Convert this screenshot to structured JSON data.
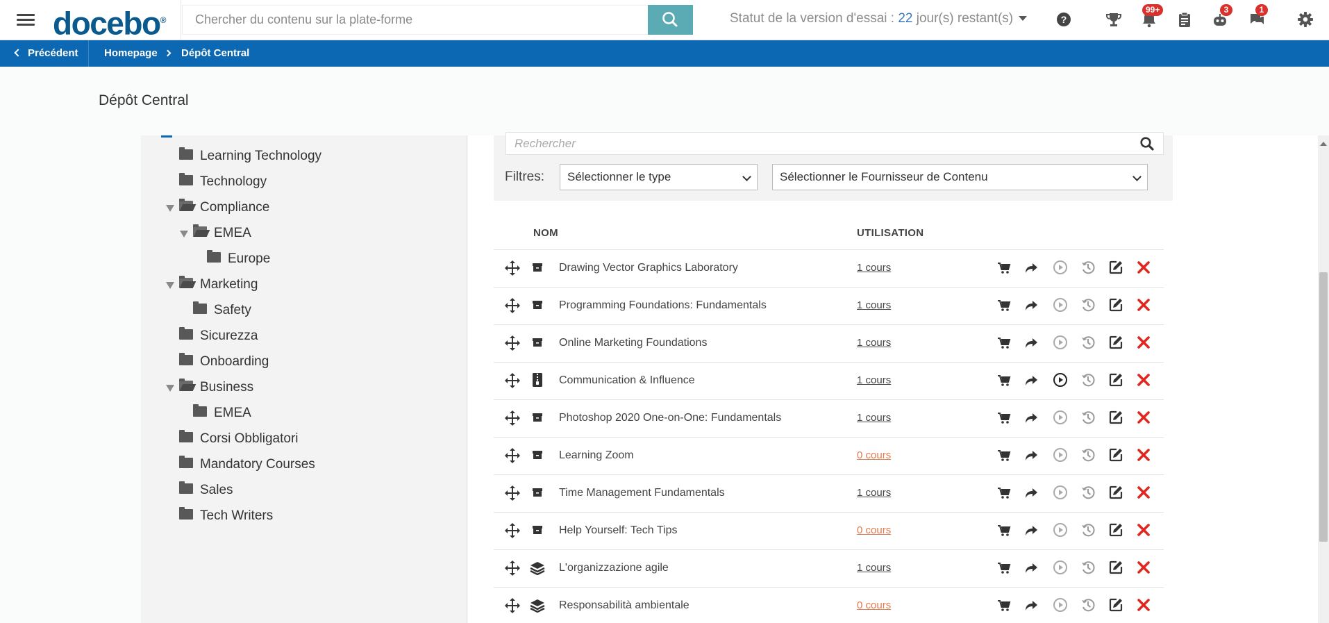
{
  "header": {
    "logo_text": "docebo",
    "logo_mark": "®",
    "search_placeholder": "Chercher du contenu sur la plate-forme",
    "trial_prefix": "Statut de la version d'essai : ",
    "trial_days": "22",
    "trial_suffix": " jour(s) restant(s)",
    "badges": {
      "notifications": "99+",
      "contests": "3",
      "messages": "1"
    },
    "icons": [
      "menu-icon",
      "search-icon",
      "help-icon",
      "trophy-icon",
      "bell-icon",
      "clipboard-icon",
      "robot-icon",
      "chat-icon",
      "gear-icon"
    ]
  },
  "breadcrumb": {
    "back_label": "Précédent",
    "home_label": "Homepage",
    "current_label": "Dépôt Central"
  },
  "page": {
    "title": "Dépôt Central"
  },
  "tree": {
    "items": [
      {
        "label": "Learning Technology",
        "expanded": false
      },
      {
        "label": "Technology",
        "expanded": false
      },
      {
        "label": "Compliance",
        "expanded": true
      },
      {
        "label": "EMEA",
        "expanded": true
      },
      {
        "label": "Europe",
        "expanded": false
      },
      {
        "label": "Marketing",
        "expanded": true
      },
      {
        "label": "Safety",
        "expanded": false
      },
      {
        "label": "Sicurezza",
        "expanded": false
      },
      {
        "label": "Onboarding",
        "expanded": false
      },
      {
        "label": "Business",
        "expanded": true
      },
      {
        "label": "EMEA",
        "expanded": false
      },
      {
        "label": "Corsi Obbligatori",
        "expanded": false
      },
      {
        "label": "Mandatory Courses",
        "expanded": false
      },
      {
        "label": "Sales",
        "expanded": false
      },
      {
        "label": "Tech Writers",
        "expanded": false
      }
    ]
  },
  "filters": {
    "search_placeholder": "Rechercher",
    "label": "Filtres:",
    "type_select": "Sélectionner le type",
    "provider_select": "Sélectionner le Fournisseur de Contenu"
  },
  "table": {
    "columns": [
      "NOM",
      "UTILISATION"
    ],
    "rows": [
      {
        "name": "Drawing Vector Graphics Laboratory",
        "usage": "1 cours",
        "type_icon": "archive-icon",
        "zero": false,
        "play_active": false
      },
      {
        "name": "Programming Foundations: Fundamentals",
        "usage": "1 cours",
        "type_icon": "archive-icon",
        "zero": false,
        "play_active": false
      },
      {
        "name": "Online Marketing Foundations",
        "usage": "1 cours",
        "type_icon": "archive-icon",
        "zero": false,
        "play_active": false
      },
      {
        "name": "Communication & Influence",
        "usage": "1 cours",
        "type_icon": "zip-file-icon",
        "zero": false,
        "play_active": true
      },
      {
        "name": "Photoshop 2020 One-on-One: Fundamentals",
        "usage": "1 cours",
        "type_icon": "archive-icon",
        "zero": false,
        "play_active": false
      },
      {
        "name": "Learning Zoom",
        "usage": "0 cours",
        "type_icon": "archive-icon",
        "zero": true,
        "play_active": false
      },
      {
        "name": "Time Management Fundamentals",
        "usage": "1 cours",
        "type_icon": "archive-icon",
        "zero": false,
        "play_active": false
      },
      {
        "name": "Help Yourself: Tech Tips",
        "usage": "0 cours",
        "type_icon": "archive-icon",
        "zero": true,
        "play_active": false
      },
      {
        "name": "L'organizzazione agile",
        "usage": "1 cours",
        "type_icon": "layers-icon",
        "zero": false,
        "play_active": false
      },
      {
        "name": "Responsabilità ambientale",
        "usage": "0 cours",
        "type_icon": "layers-icon",
        "zero": true,
        "play_active": false
      }
    ],
    "actions": [
      "cart-icon",
      "share-icon",
      "play-icon",
      "history-icon",
      "edit-icon",
      "delete-icon"
    ]
  },
  "colors": {
    "brand_blue": "#0c68b2",
    "search_button": "#5aabb4",
    "badge_red": "#d9312b",
    "delete_red": "#e0261f",
    "zero_usage": "#e07a4f"
  }
}
